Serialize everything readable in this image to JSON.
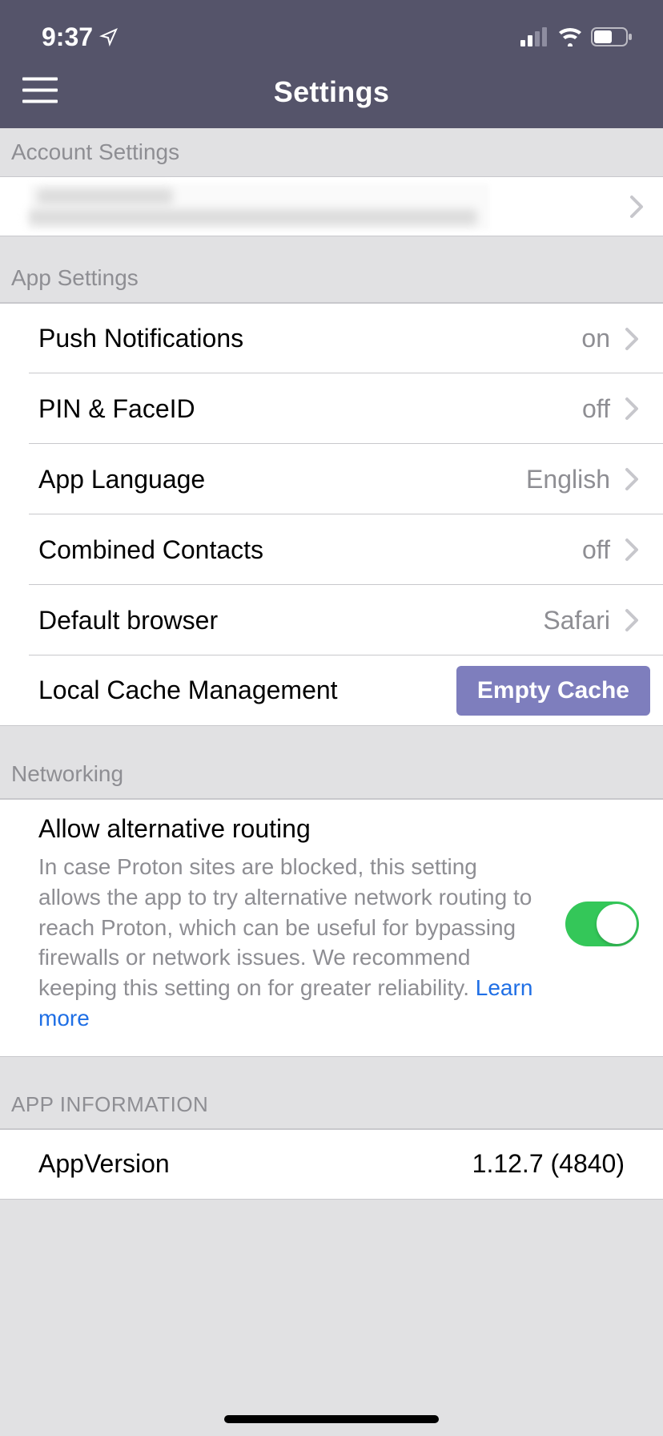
{
  "status": {
    "time": "9:37"
  },
  "nav": {
    "title": "Settings"
  },
  "sections": {
    "account": {
      "header": "Account Settings"
    },
    "app": {
      "header": "App Settings",
      "push": {
        "label": "Push Notifications",
        "value": "on"
      },
      "pin": {
        "label": "PIN & FaceID",
        "value": "off"
      },
      "lang": {
        "label": "App Language",
        "value": "English"
      },
      "contacts": {
        "label": "Combined Contacts",
        "value": "off"
      },
      "browser": {
        "label": "Default browser",
        "value": "Safari"
      },
      "cache": {
        "label": "Local Cache Management",
        "button": "Empty Cache"
      }
    },
    "networking": {
      "header": "Networking",
      "title": "Allow alternative routing",
      "desc": "In case Proton sites are blocked, this setting allows the app to try alternative network routing to reach Proton, which can be useful for bypassing firewalls or network issues. We recommend keeping this setting on for greater reliability. ",
      "link": "Learn more"
    },
    "info": {
      "header": "APP INFORMATION",
      "version": {
        "label": "AppVersion",
        "value": "1.12.7 (4840)"
      }
    }
  }
}
